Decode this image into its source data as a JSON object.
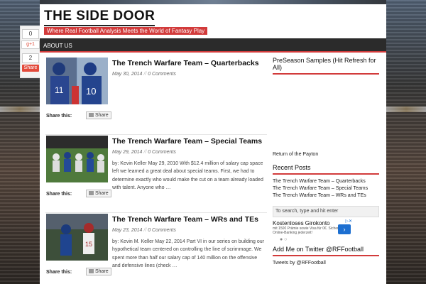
{
  "share_bar": {
    "count_top": "0",
    "gplus_label": "g+1",
    "count_mid": "2",
    "share_label": "Share"
  },
  "site": {
    "title": "THE SIDE DOOR",
    "tagline": "Where Real Football Analysis Meets the World of Fantasy Play"
  },
  "nav": {
    "items": [
      "ABOUT US"
    ]
  },
  "posts": [
    {
      "title": "The Trench Warfare Team – Quarterbacks",
      "date": "May 30, 2014",
      "comments": "0 Comments",
      "excerpt": "",
      "share_label": "Share this:",
      "share_button": "Share"
    },
    {
      "title": "The Trench Warfare Team – Special Teams",
      "date": "May 29, 2014",
      "comments": "0 Comments",
      "excerpt": "by: Kevin Keller May 29, 2010        With $12.4 million of salary cap space left we learned a great deal about special teams.  First, we had to determine exactly who would make the cut on a team already loaded with talent.  Anyone who …",
      "share_label": "Share this:",
      "share_button": "Share"
    },
    {
      "title": "The Trench Warfare Team – WRs and TEs",
      "date": "May 23, 2014",
      "comments": "0 Comments",
      "excerpt": "by: Kevin M. Keller May 22, 2014       Part VI in our series on building our hypothetical team centered on controlling the line of scrimmage.  We spent more than half our salary cap of 140 million on the offensive and defensive lines (check …",
      "share_label": "Share this:",
      "share_button": "Share"
    }
  ],
  "sidebar": {
    "preseason_title": "PreSeason Samples (Hit Refresh for All)",
    "preseason_text": "Return of the Payton",
    "recent_title": "Recent Posts",
    "recent_posts": [
      "The Trench Warfare Team – Quarterbacks",
      "The Trench Warfare Team – Special Teams",
      "The Trench Warfare Team – WRs and TEs"
    ],
    "search_placeholder": "To search, type and hit enter",
    "ad_title": "Kostenloses Girokonto",
    "ad_sub": "mit 150€ Prämie sowie Visa für 0€. Sicheres Online-Banking jederzeit!",
    "twitter_title": "Add Me on Twitter @RFFootball",
    "twitter_text": "Tweets by @RFFootball"
  }
}
